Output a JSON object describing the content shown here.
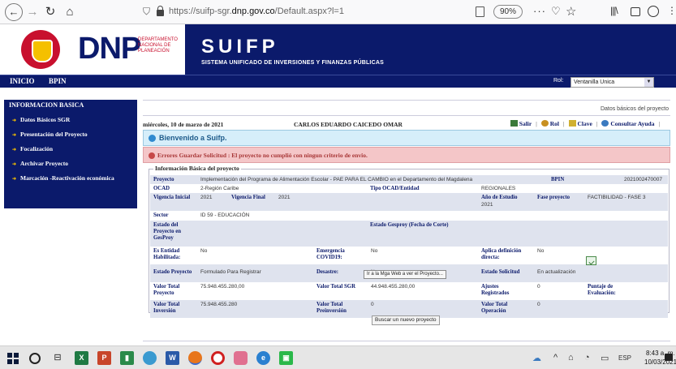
{
  "browser": {
    "url_prefix": "https://suifp-sgr.",
    "url_domain": "dnp.gov.co",
    "url_suffix": "/Default.aspx?l=1",
    "zoom": "90%"
  },
  "header": {
    "dnp": "DNP",
    "dnp_sub": "DEPARTAMENTO NACIONAL DE PLANEACIÓN",
    "suifp": "SUIFP",
    "suifp_sub": "SISTEMA UNIFICADO DE INVERSIONES Y FINANZAS PÚBLICAS"
  },
  "menu": {
    "inicio": "INICIO",
    "bpin": "BPIN",
    "rol_label": "Rol:",
    "rol_value": "Ventanilla Unica"
  },
  "sidebar": {
    "title": "INFORMACION BASICA",
    "items": [
      "Datos Básicos SGR",
      "Presentación del Proyecto",
      "Focalización",
      "Archivar Proyecto",
      "Marcación -Reactivación económica"
    ]
  },
  "main": {
    "basic_link": "Datos básicos del proyecto",
    "date": "miércoles, 10 de marzo de 2021",
    "user": "CARLOS EDUARDO CAICEDO OMAR",
    "actions": {
      "salir": "Salir",
      "rol": "Rol",
      "clave": "Clave",
      "ayuda": "Consultar Ayuda"
    },
    "welcome": "Bienvenido a Suifp.",
    "error": "Errores Guardar Solicitud : El proyecto no cumplió con ningun criterio de envio.",
    "legend": "Información Básica del proyecto",
    "rows": [
      {
        "proyecto_l": "Proyecto",
        "proyecto_v": "Implementación del Programa de Alimentación Escolar - PAE PARA EL CAMBIO en el Departamento del Magdalena",
        "bpin_l": "BPIN",
        "bpin_v": "2021002470007"
      },
      {
        "ocad_l": "OCAD",
        "ocad_v": "2-Región Caribe",
        "tipo_l": "Tipo OCAD/Entidad",
        "tipo_v": "REGIONALES"
      },
      {
        "vi_l": "Vigencia Inicial",
        "vi_v": "2021",
        "vf_l": "Vigencia Final",
        "vf_v": "2021",
        "ae_l": "Año de Estudio",
        "ae_v": "2021",
        "fp_l": "Fase proyecto",
        "fp_v": "FACTIBILIDAD - FASE 3"
      },
      {
        "sector_l": "Sector",
        "sector_v": "ID 59 - EDUCACIÓN"
      },
      {
        "estado_l": "Estado del Proyecto en GesProy",
        "gesproy_l": "Estado Gesproy (Fecha de Corte)"
      },
      {
        "ent_l": "Es Entidad Habilitada:",
        "ent_v": "No",
        "emer_l": "Emergencia COVID19:",
        "emer_v": "No",
        "apl_l": "Aplica definición directa:",
        "apl_v": "No"
      },
      {
        "ep_l": "Estado Proyecto",
        "ep_v": "Formulado Para Registrar",
        "des_l": "Desastre:",
        "des_v": "No",
        "es_l": "Estado Solicitud",
        "es_v": "En actualización"
      },
      {
        "vtp_l": "Valor Total Proyecto",
        "vtp_v": "75.948.455.280,00",
        "vts_l": "Valor Total SGR",
        "vts_v": "44.948.455.280,00",
        "aj_l": "Ajustes Registrados",
        "aj_v": "0",
        "pe_l": "Puntaje de Evaluación:"
      },
      {
        "vti_l": "Valor Total Inversión",
        "vti_v": "75.948.455.280",
        "vtpr_l": "Valor Total Preinversión",
        "vtpr_v": "0",
        "vto_l": "Valor Total Operación",
        "vto_v": "0"
      }
    ],
    "tooltip": "Ir a la Mga Web a ver el Proyecto...",
    "search_button": "Buscar un nuevo proyecto"
  },
  "taskbar": {
    "lang": "ESP",
    "time": "8:43 a. m.",
    "date": "10/03/2021"
  }
}
